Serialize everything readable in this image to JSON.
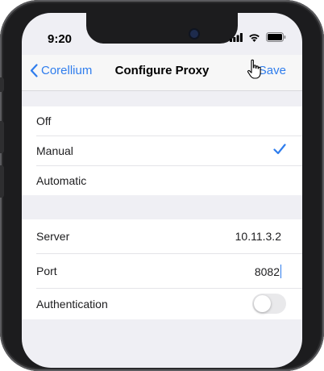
{
  "status_bar": {
    "time": "9:20"
  },
  "nav": {
    "back_label": "Corellium",
    "title": "Configure Proxy",
    "save_label": "Save"
  },
  "proxy_modes": [
    {
      "label": "Off",
      "selected": false
    },
    {
      "label": "Manual",
      "selected": true
    },
    {
      "label": "Automatic",
      "selected": false
    }
  ],
  "manual": {
    "server_label": "Server",
    "server_value": "10.11.3.2",
    "port_label": "Port",
    "port_value": "8082",
    "auth_label": "Authentication",
    "auth_enabled": false
  },
  "colors": {
    "accent": "#2f7ded",
    "background": "#efeff4",
    "toggle_off": "#e9e9eb"
  }
}
